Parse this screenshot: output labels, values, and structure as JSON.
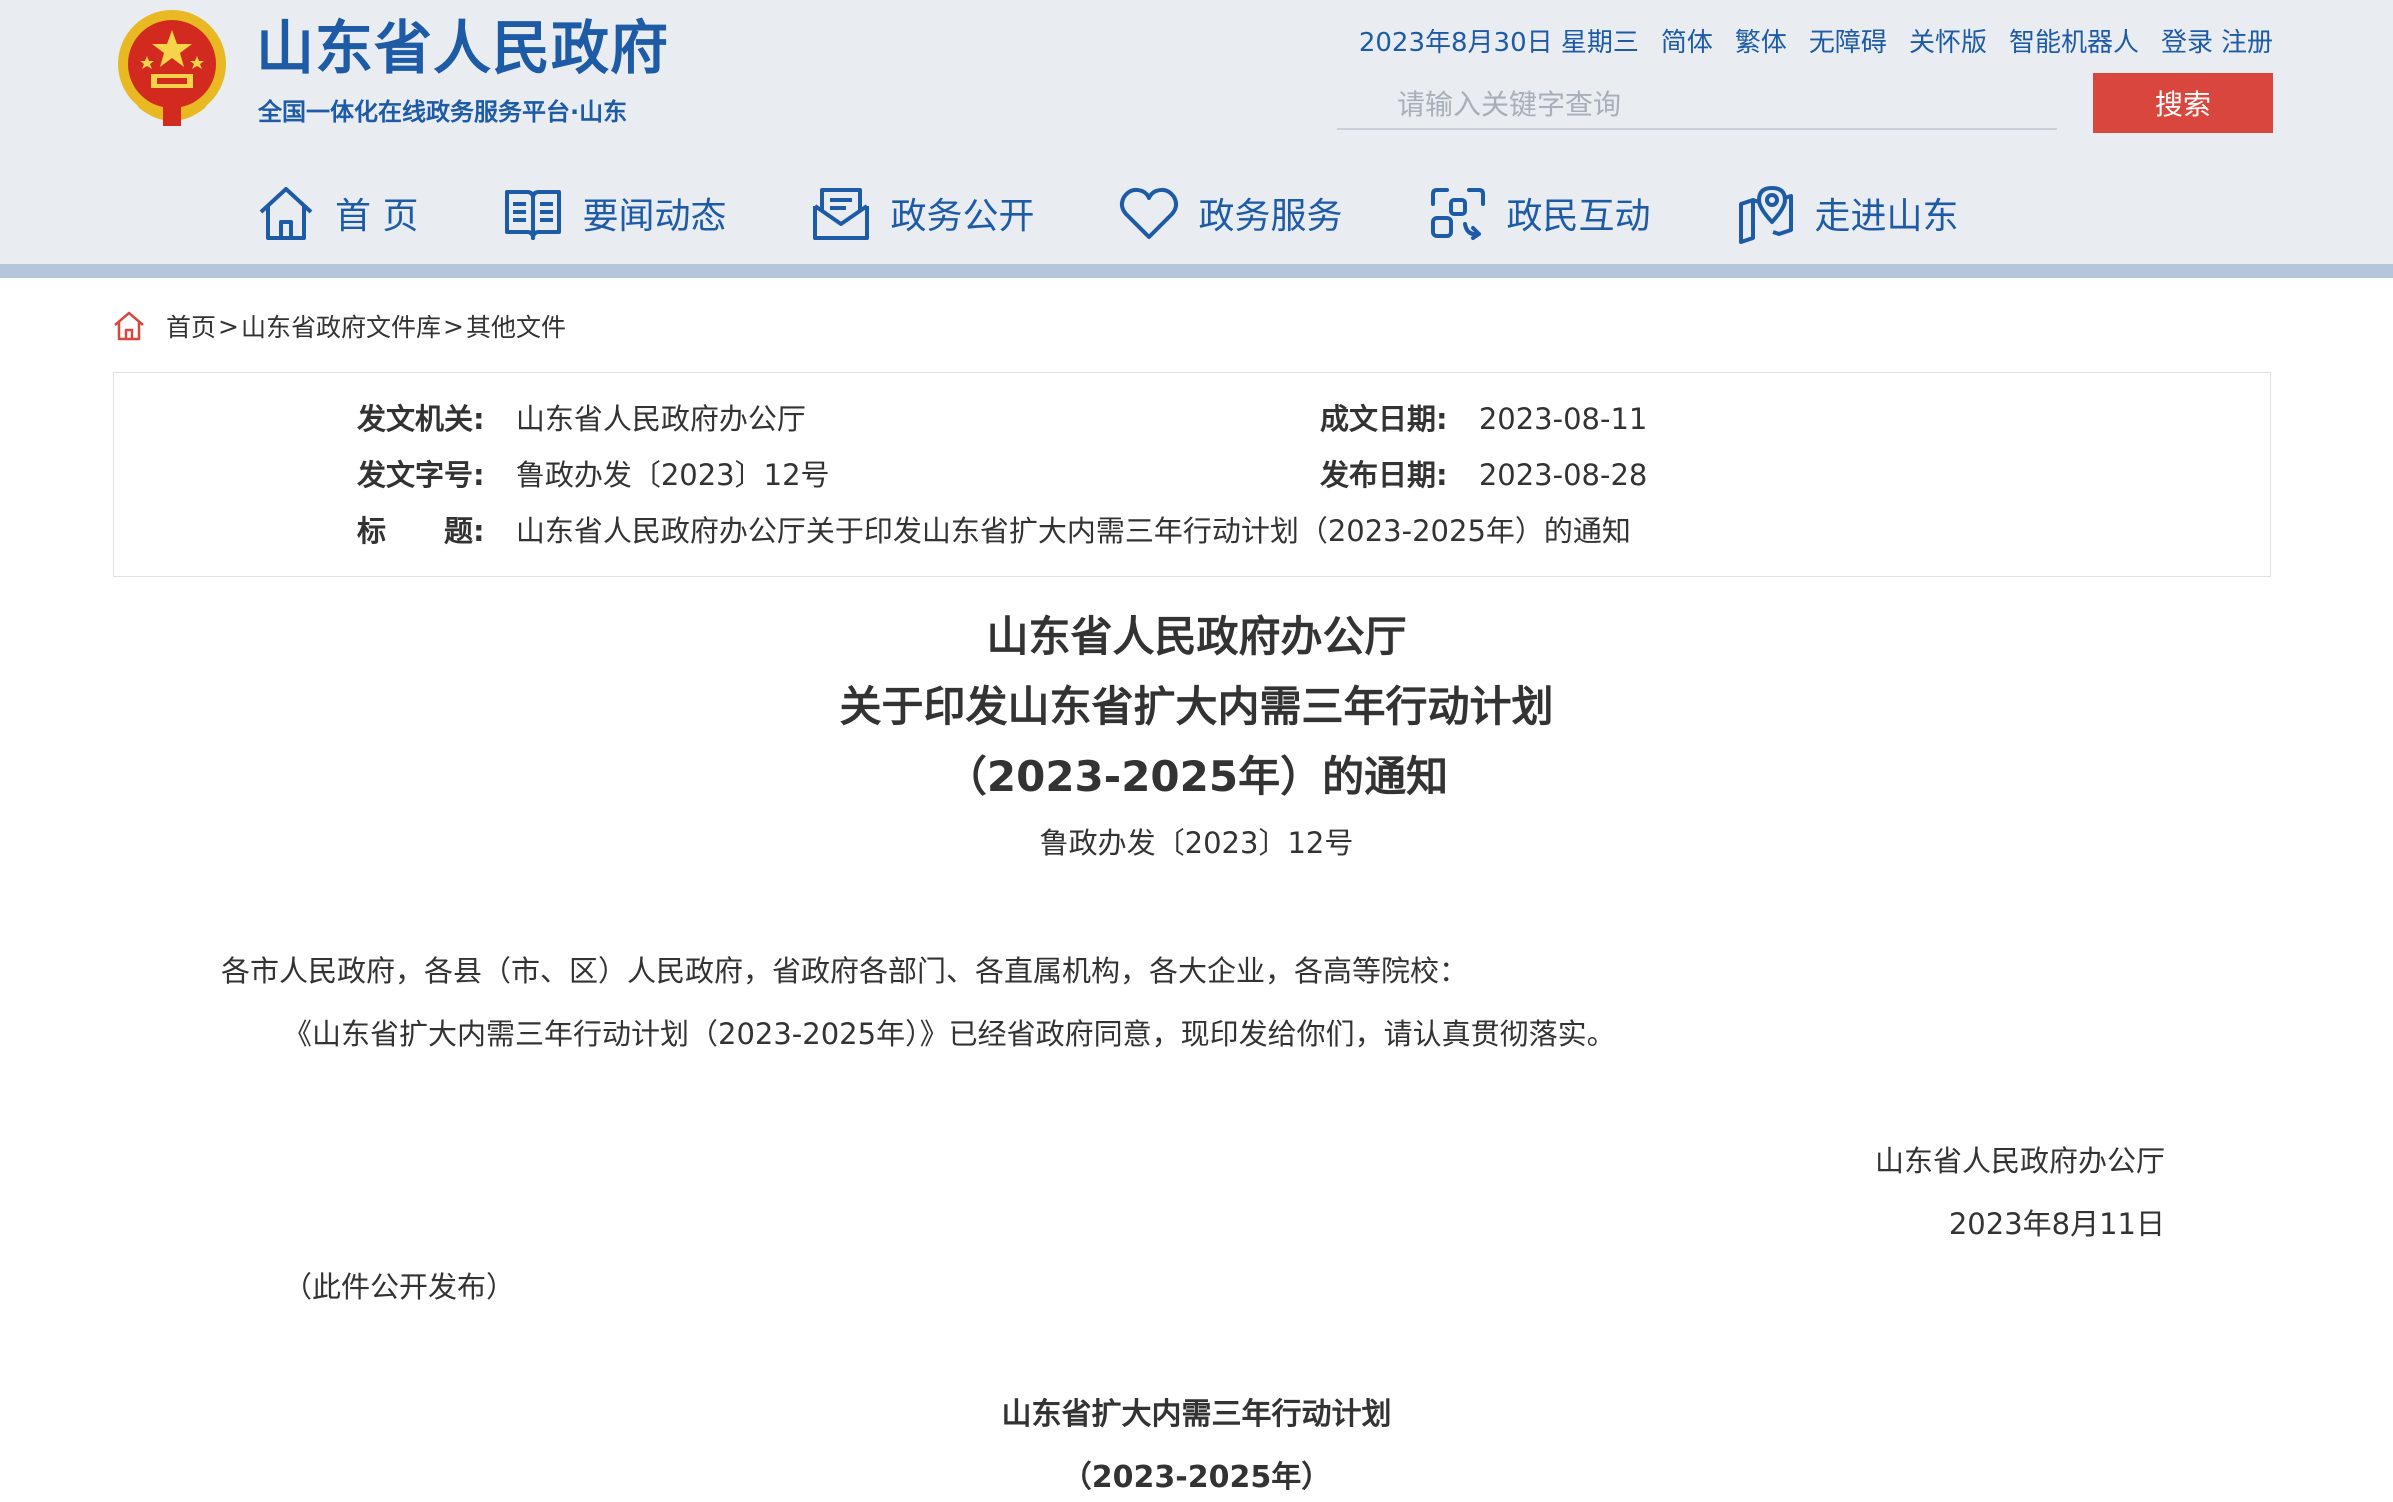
{
  "header": {
    "site_title": "山东省人民政府",
    "site_subtitle": "全国一体化在线政务服务平台·山东",
    "date": "2023年8月30日 星期三",
    "links": [
      "简体",
      "繁体",
      "无障碍",
      "关怀版",
      "智能机器人",
      "登录",
      "注册"
    ],
    "search_placeholder": "请输入关键字查询",
    "search_button": "搜索",
    "colors": {
      "brand": "#1d5ba6",
      "search_button": "#d9463d",
      "header_bg": "#e9ecf1"
    }
  },
  "nav": [
    {
      "label": "首 页",
      "icon": "home-icon"
    },
    {
      "label": "要闻动态",
      "icon": "book-icon"
    },
    {
      "label": "政务公开",
      "icon": "mail-icon"
    },
    {
      "label": "政务服务",
      "icon": "heart-icon"
    },
    {
      "label": "政民互动",
      "icon": "interaction-icon"
    },
    {
      "label": "走进山东",
      "icon": "map-pin-icon"
    }
  ],
  "breadcrumb": [
    "首页",
    "山东省政府文件库",
    "其他文件"
  ],
  "meta": {
    "issuer_label": "发文机关:",
    "issuer": "山东省人民政府办公厅",
    "written_date_label": "成文日期:",
    "written_date": "2023-08-11",
    "doc_no_label": "发文字号:",
    "doc_no": "鲁政办发〔2023〕12号",
    "publish_date_label": "发布日期:",
    "publish_date": "2023-08-28",
    "title_label": "标　　题:",
    "title": "山东省人民政府办公厅关于印发山东省扩大内需三年行动计划（2023-2025年）的通知"
  },
  "document": {
    "title_line1": "山东省人民政府办公厅",
    "title_line2": "关于印发山东省扩大内需三年行动计划",
    "title_line3": "（2023-2025年）的通知",
    "doc_number": "鲁政办发〔2023〕12号",
    "recipients": "各市人民政府，各县（市、区）人民政府，省政府各部门、各直属机构，各大企业，各高等院校：",
    "body": "《山东省扩大内需三年行动计划（2023-2025年）》已经省政府同意，现印发给你们，请认真贯彻落实。",
    "signature": "山东省人民政府办公厅",
    "sign_date": "2023年8月11日",
    "publish_note": "（此件公开发布）",
    "plan_title": "山东省扩大内需三年行动计划",
    "plan_period": "（2023-2025年）"
  }
}
